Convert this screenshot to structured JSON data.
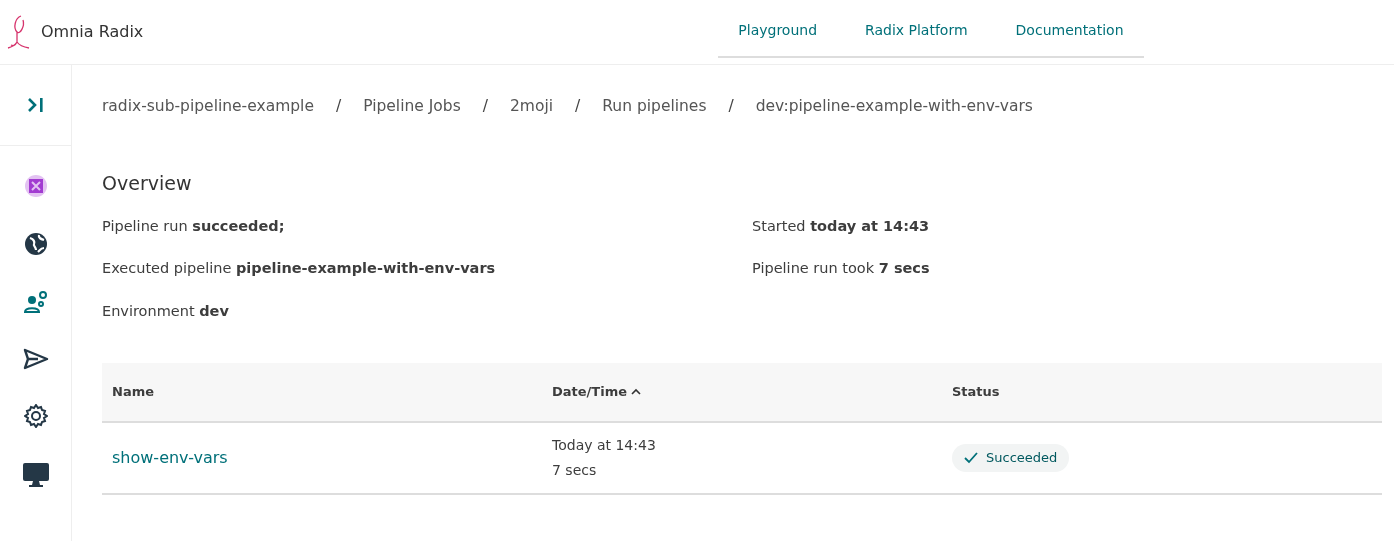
{
  "app": {
    "title": "Omnia Radix"
  },
  "top_nav": [
    {
      "label": "Playground"
    },
    {
      "label": "Radix Platform"
    },
    {
      "label": "Documentation"
    }
  ],
  "breadcrumb": [
    {
      "kind": "link",
      "text": "radix-sub-pipeline-example"
    },
    {
      "kind": "separator",
      "text": "/"
    },
    {
      "kind": "link",
      "text": "Pipeline Jobs"
    },
    {
      "kind": "separator",
      "text": "/"
    },
    {
      "kind": "link",
      "text": "2moji"
    },
    {
      "kind": "separator",
      "text": "/"
    },
    {
      "kind": "link",
      "text": "Run pipelines"
    },
    {
      "kind": "separator",
      "text": "/"
    },
    {
      "kind": "link",
      "text": "dev:pipeline-example-with-env-vars"
    }
  ],
  "overview": {
    "title": "Overview",
    "left": [
      "Pipeline run **succeeded;**",
      "Executed pipeline **pipeline-example-with-env-vars**",
      "Environment **dev**"
    ],
    "right": [
      "Started **today at 14:43**",
      "Pipeline run took **7 secs**"
    ]
  },
  "table": {
    "columns": [
      {
        "label": "Name",
        "sorted": false
      },
      {
        "label": "Date/Time",
        "sorted": true
      },
      {
        "label": "Status",
        "sorted": false
      }
    ],
    "rows": [
      {
        "name": "show-env-vars",
        "date": "Today at 14:43",
        "duration": "7 secs",
        "status": {
          "label": "Succeeded",
          "kind": "succeeded"
        }
      }
    ]
  }
}
